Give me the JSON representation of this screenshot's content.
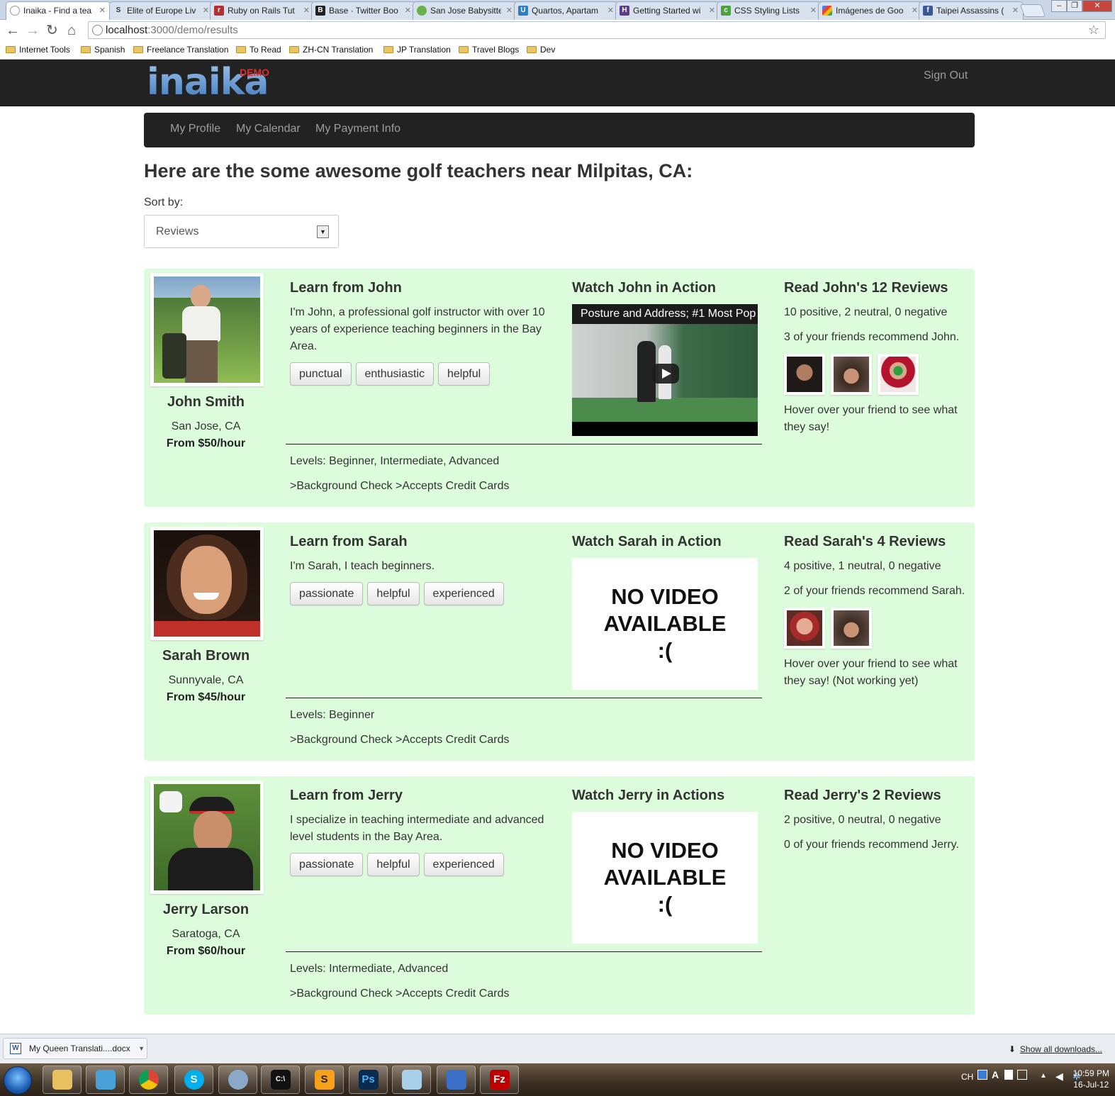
{
  "browser": {
    "tabs": [
      {
        "label": "Inaika - Find a tea",
        "favicon": "globe-icon",
        "active": true
      },
      {
        "label": "Elite of Europe Liv",
        "favicon": "s-icon"
      },
      {
        "label": "Ruby on Rails Tut",
        "favicon": "rails-icon"
      },
      {
        "label": "Base · Twitter Boo",
        "favicon": "b-icon"
      },
      {
        "label": "San Jose Babysitte",
        "favicon": "flower-icon"
      },
      {
        "label": "Quartos, Apartam",
        "favicon": "u-icon"
      },
      {
        "label": "Getting Started wi",
        "favicon": "h-icon"
      },
      {
        "label": "CSS Styling Lists",
        "favicon": "css-icon"
      },
      {
        "label": "Imágenes de Goo",
        "favicon": "google-icon"
      },
      {
        "label": "Taipei Assassins (",
        "favicon": "facebook-icon"
      }
    ],
    "url_host": "localhost",
    "url_path": ":3000/demo/results",
    "bookmarks": [
      "Internet Tools",
      "Spanish",
      "Freelance Translation",
      "To Read",
      "ZH-CN Translation",
      "JP Translation",
      "Travel Blogs",
      "Dev"
    ]
  },
  "site": {
    "logo": "inaika",
    "logo_badge": "DEMO",
    "signout": "Sign Out",
    "nav": [
      "My Profile",
      "My Calendar",
      "My Payment Info"
    ],
    "heading": "Here are the some awesome golf teachers near Milpitas, CA:",
    "sort_label": "Sort by:",
    "sort_value": "Reviews"
  },
  "teachers": [
    {
      "name": "John Smith",
      "location": "San Jose, CA",
      "price": "From $50/hour",
      "learn_title": "Learn from John",
      "bio": "I'm John, a professional golf instructor with over 10 years of experience teaching beginners in the Bay Area.",
      "tags": [
        "punctual",
        "enthusiastic",
        "helpful"
      ],
      "watch_title": "Watch John in Action",
      "video_title": "Posture and Address; #1 Most Pop",
      "reviews_title": "Read John's 12 Reviews",
      "review_summary": "10 positive, 2 neutral, 0 negative",
      "friends_recommend": "3 of your friends recommend John.",
      "hover_note": "Hover over your friend to see what they say!",
      "levels": "Levels: Beginner, Intermediate, Advanced",
      "features": ">Background Check >Accepts Credit Cards"
    },
    {
      "name": "Sarah Brown",
      "location": "Sunnyvale, CA",
      "price": "From $45/hour",
      "learn_title": "Learn from Sarah",
      "bio": "I'm Sarah, I teach beginners.",
      "tags": [
        "passionate",
        "helpful",
        "experienced"
      ],
      "watch_title": "Watch Sarah in Action",
      "no_video": "NO VIDEO\nAVAILABLE\n:(",
      "reviews_title": "Read Sarah's 4 Reviews",
      "review_summary": "4 positive, 1 neutral, 0 negative",
      "friends_recommend": "2 of your friends recommend Sarah.",
      "hover_note": "Hover over your friend to see what they say! (Not working yet)",
      "levels": "Levels: Beginner",
      "features": ">Background Check >Accepts Credit Cards"
    },
    {
      "name": "Jerry Larson",
      "location": "Saratoga, CA",
      "price": "From $60/hour",
      "learn_title": "Learn from Jerry",
      "bio": "I specialize in teaching intermediate and advanced level students in the Bay Area.",
      "tags": [
        "passionate",
        "helpful",
        "experienced"
      ],
      "watch_title": "Watch Jerry in Actions",
      "no_video": "NO VIDEO\nAVAILABLE\n:(",
      "reviews_title": "Read Jerry's 2 Reviews",
      "review_summary": "2 positive, 0 neutral, 0 negative",
      "friends_recommend": "0 of your friends recommend Jerry.",
      "levels": "Levels: Intermediate, Advanced",
      "features": ">Background Check >Accepts Credit Cards"
    }
  ],
  "downloads": {
    "file": "My Queen Translati....docx",
    "show_all": "Show all downloads..."
  },
  "taskbar": {
    "lang": "CH",
    "time": "10:59 PM",
    "date": "16-Jul-12"
  },
  "colors": {
    "card_bg": "#dcfcdc",
    "header_bg": "#222222",
    "logo_blue": "#6e9fd6",
    "demo_red": "#e02b2b"
  }
}
